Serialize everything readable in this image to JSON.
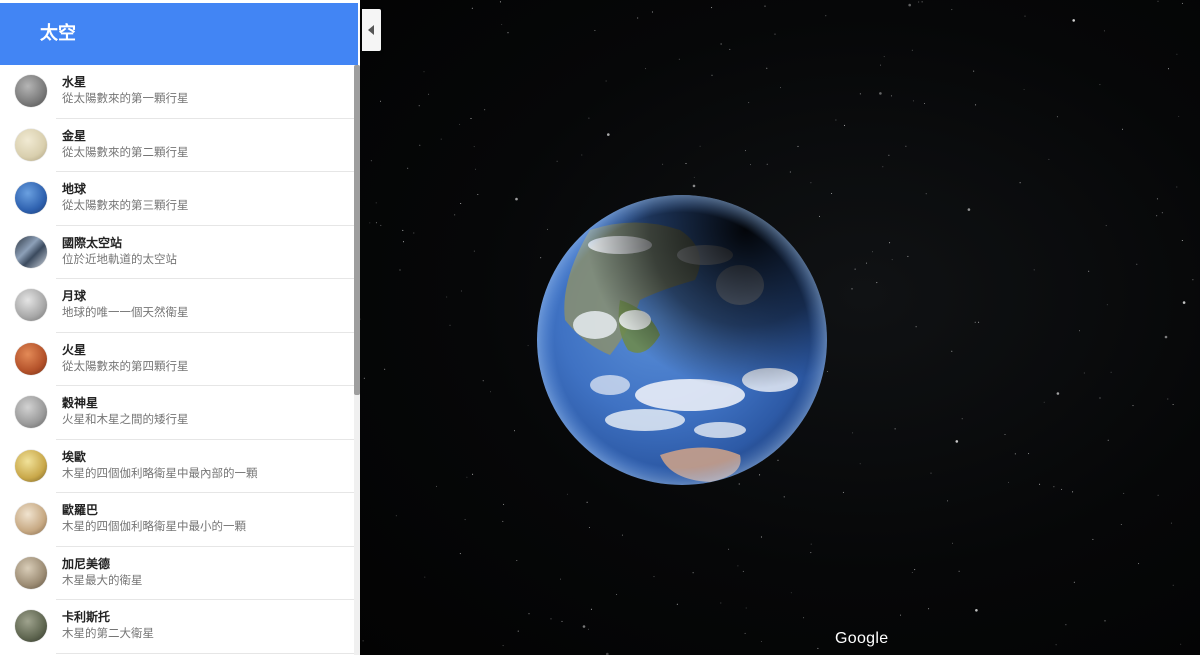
{
  "sidebar": {
    "title": "太空",
    "header_color": "#4285f4",
    "items": [
      {
        "name": "水星",
        "description": "從太陽數來的第一顆行星",
        "icon": "mercury-icon"
      },
      {
        "name": "金星",
        "description": "從太陽數來的第二顆行星",
        "icon": "venus-icon"
      },
      {
        "name": "地球",
        "description": "從太陽數來的第三顆行星",
        "icon": "earth-icon"
      },
      {
        "name": "國際太空站",
        "description": "位於近地軌道的太空站",
        "icon": "space-station-icon"
      },
      {
        "name": "月球",
        "description": "地球的唯一一個天然衛星",
        "icon": "moon-icon"
      },
      {
        "name": "火星",
        "description": "從太陽數來的第四顆行星",
        "icon": "mars-icon"
      },
      {
        "name": "穀神星",
        "description": "火星和木星之間的矮行星",
        "icon": "ceres-icon"
      },
      {
        "name": "埃歐",
        "description": "木星的四個伽利略衛星中最內部的一顆",
        "icon": "io-icon"
      },
      {
        "name": "歐羅巴",
        "description": "木星的四個伽利略衛星中最小的一顆",
        "icon": "europa-icon"
      },
      {
        "name": "加尼美德",
        "description": "木星最大的衛星",
        "icon": "ganymede-icon"
      },
      {
        "name": "卡利斯托",
        "description": "木星的第二大衛星",
        "icon": "callisto-icon"
      }
    ]
  },
  "collapse_button": {
    "icon": "chevron-left-icon"
  },
  "viewport": {
    "logo": "Google",
    "globe_icon": "earth-globe"
  }
}
